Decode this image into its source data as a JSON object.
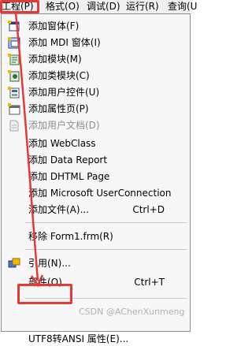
{
  "menubar": {
    "items": [
      {
        "label": "工程(P)"
      },
      {
        "label": "格式(O)"
      },
      {
        "label": "调试(D)"
      },
      {
        "label": "运行(R)"
      },
      {
        "label": "查询(U"
      }
    ]
  },
  "menu": {
    "items": [
      {
        "label": "添加窗体(F)",
        "icon": "form-icon"
      },
      {
        "label": "添加 MDI 窗体(I)",
        "icon": "mdi-form-icon"
      },
      {
        "label": "添加模块(M)",
        "icon": "module-icon"
      },
      {
        "label": "添加类模块(C)",
        "icon": "class-module-icon"
      },
      {
        "label": "添加用户控件(U)",
        "icon": "user-control-icon"
      },
      {
        "label": "添加属性页(P)",
        "icon": "property-page-icon"
      },
      {
        "label": "添加用户文档(D)",
        "icon": "user-document-icon",
        "disabled": true
      },
      {
        "label": "添加 WebClass"
      },
      {
        "label": "添加 Data Report"
      },
      {
        "label": "添加 DHTML Page"
      },
      {
        "label": "添加 Microsoft UserConnection"
      },
      {
        "label": "添加文件(A)...",
        "shortcut": "Ctrl+D"
      },
      {
        "label": "移除 Form1.frm(R)"
      },
      {
        "label": "引用(N)...",
        "icon": "references-icon"
      },
      {
        "label": "部件(O)...",
        "shortcut": "Ctrl+T"
      },
      {
        "label": "UTF8转ANSI 属性(E)..."
      }
    ]
  },
  "watermark": "CSDN @AChenXunmeng",
  "colors": {
    "highlight": "#e53935",
    "menu_bg": "#f7f7f7"
  }
}
